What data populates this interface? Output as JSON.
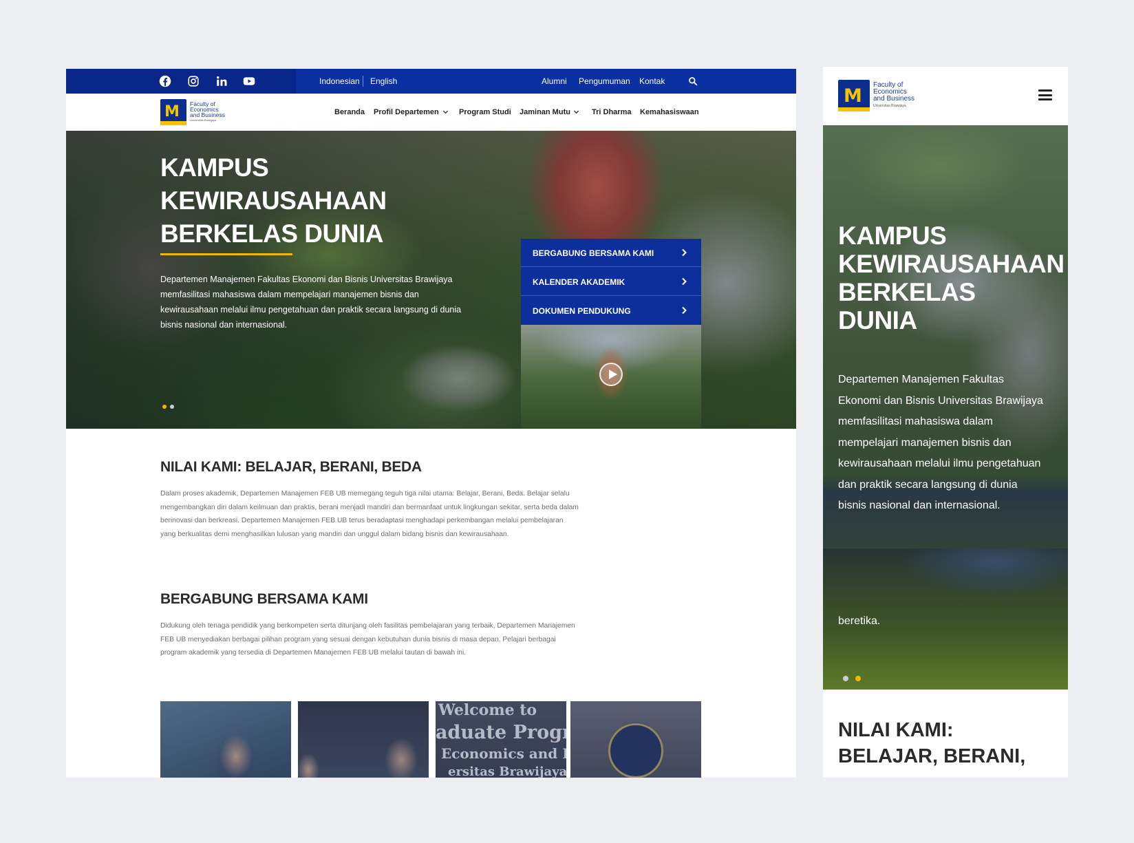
{
  "desktop": {
    "topbar": {
      "social_icons": [
        "facebook-icon",
        "instagram-icon",
        "linkedin-icon",
        "youtube-icon"
      ],
      "languages": [
        "Indonesian",
        "English"
      ],
      "links": [
        "Alumni",
        "Pengumuman",
        "Kontak"
      ]
    },
    "logo": {
      "line1": "Faculty of",
      "line2": "Economics",
      "line3": "and Business",
      "line4": "Universitas Brawijaya"
    },
    "nav": [
      "Beranda",
      "Profil Departemen",
      "Program Studi",
      "Jaminan Mutu",
      "Tri Dharma",
      "Kemahasiswaan"
    ],
    "hero": {
      "title_lines": [
        "KAMPUS",
        "KEWIRAUSAHAAN",
        "BERKELAS DUNIA"
      ],
      "description": "Departemen Manajemen Fakultas Ekonomi dan Bisnis Universitas Brawijaya memfasilitasi mahasiswa dalam mempelajari manajemen bisnis dan kewirausahaan melalui ilmu pengetahuan dan praktik secara langsung di dunia bisnis nasional dan internasional.",
      "quick_links": [
        "BERGABUNG BERSAMA KAMI",
        "KALENDER AKADEMIK",
        "DOKUMEN PENDUKUNG"
      ],
      "accent_color": "#f2b705"
    },
    "values": {
      "title": "NILAI KAMI: BELAJAR, BERANI, BEDA",
      "body": "Dalam proses akademik, Departemen Manajemen FEB UB memegang teguh tiga nilai utama: Belajar, Berani, Beda. Belajar selalu mengembangkan diri dalam keilmuan dan praktis, berani menjadi mandiri dan bermanfaat untuk lingkungan sekitar, serta beda dalam berinovasi dan berkreasi. Departemen Manajemen FEB UB terus beradaptasi menghadapi perkembangan melalui pembelajaran yang berkualitas demi menghasilkan lulusan yang mandiri dan unggul dalam bidang bisnis dan kewirausahaan."
    },
    "join": {
      "title": "BERGABUNG BERSAMA KAMI",
      "body": "Didukung oleh tenaga pendidik yang berkompeten serta ditunjang oleh fasilitas pembelajaran yang terbaik,  Departemen Manajemen FEB UB menyediakan berbagai pilihan program yang sesuai dengan kebutuhan dunia bisnis di masa depan. Pelajari berbagai program akademik yang tersedia di Departemen Manajemen FEB UB melalui tautan di bawah ini."
    },
    "thumbnail_text": [
      "Welcome to",
      "aduate Program",
      "Economics and Bu",
      "ersitas Brawijaya"
    ]
  },
  "mobile": {
    "hero": {
      "title_lines": [
        "KAMPUS",
        "KEWIRAUSAHAAN",
        "BERKELAS",
        "DUNIA"
      ],
      "description": "Departemen Manajemen Fakultas Ekonomi dan Bisnis Universitas Brawijaya memfasilitasi mahasiswa dalam mempelajari manajemen bisnis dan kewirausahaan melalui ilmu pengetahuan dan praktik secara langsung di dunia bisnis nasional dan internasional.",
      "extra": "beretika."
    },
    "section_title_lines": [
      "NILAI KAMI:",
      "BELAJAR, BERANI,"
    ]
  },
  "colors": {
    "brand_blue": "#0a2fa0",
    "brand_yellow": "#f2b705",
    "background": "#eceef2"
  }
}
